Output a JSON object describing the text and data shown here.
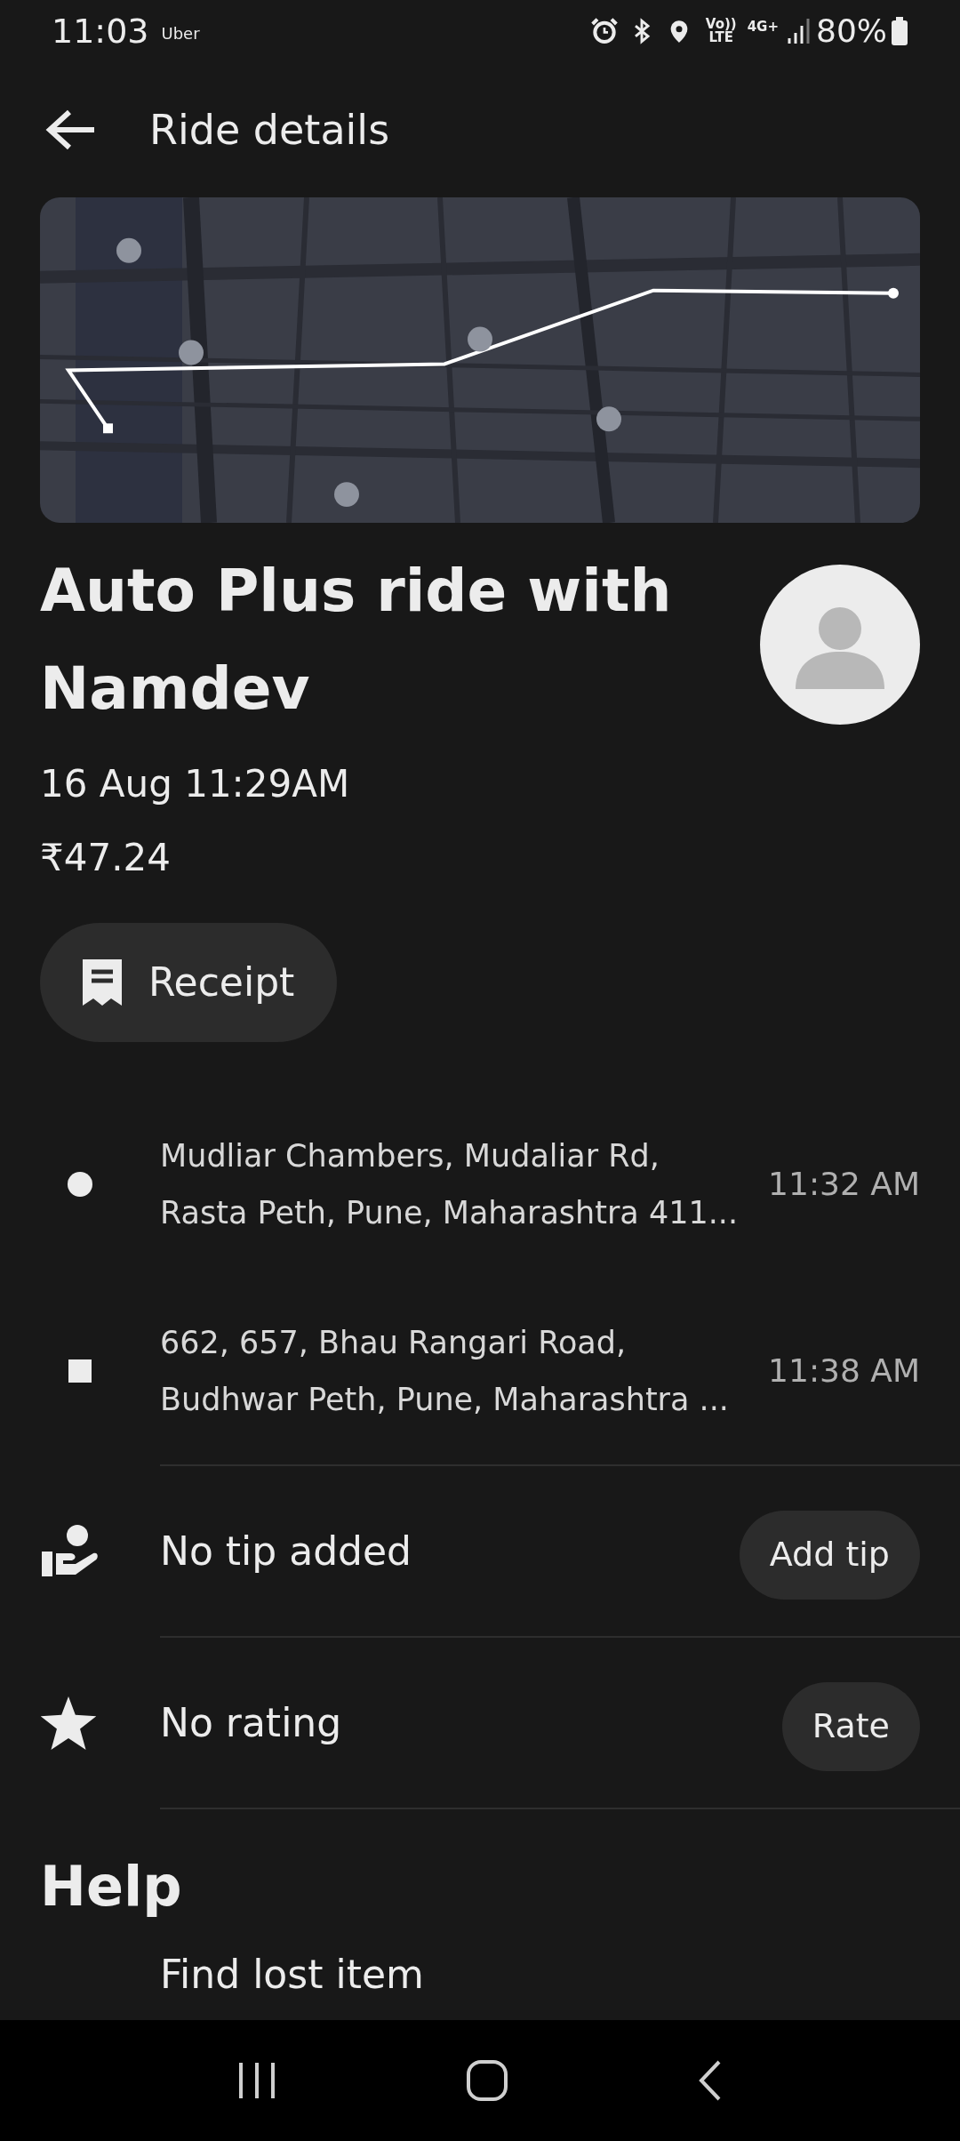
{
  "status_bar": {
    "time": "11:03",
    "app": "Uber",
    "volte_top": "Vo))",
    "volte_bottom": "LTE",
    "network": "4G+",
    "battery": "80%"
  },
  "header": {
    "title": "Ride details"
  },
  "ride": {
    "title": "Auto Plus ride with Namdev",
    "date": "16 Aug 11:29AM",
    "fare": "₹47.24",
    "receipt_button": "Receipt"
  },
  "stops": [
    {
      "kind": "pickup",
      "line1": "Mudliar Chambers, Mudaliar Rd,",
      "line2": "Rasta Peth, Pune, Maharashtra 411...",
      "time": "11:32 AM"
    },
    {
      "kind": "dropoff",
      "line1": "662, 657, Bhau Rangari Road,",
      "line2": "Budhwar Peth, Pune, Maharashtra ...",
      "time": "11:38 AM"
    }
  ],
  "actions": [
    {
      "kind": "tip",
      "label": "No tip added",
      "button": "Add tip"
    },
    {
      "kind": "rating",
      "label": "No rating",
      "button": "Rate"
    }
  ],
  "help": {
    "title": "Help",
    "items": [
      "Find lost item"
    ]
  }
}
